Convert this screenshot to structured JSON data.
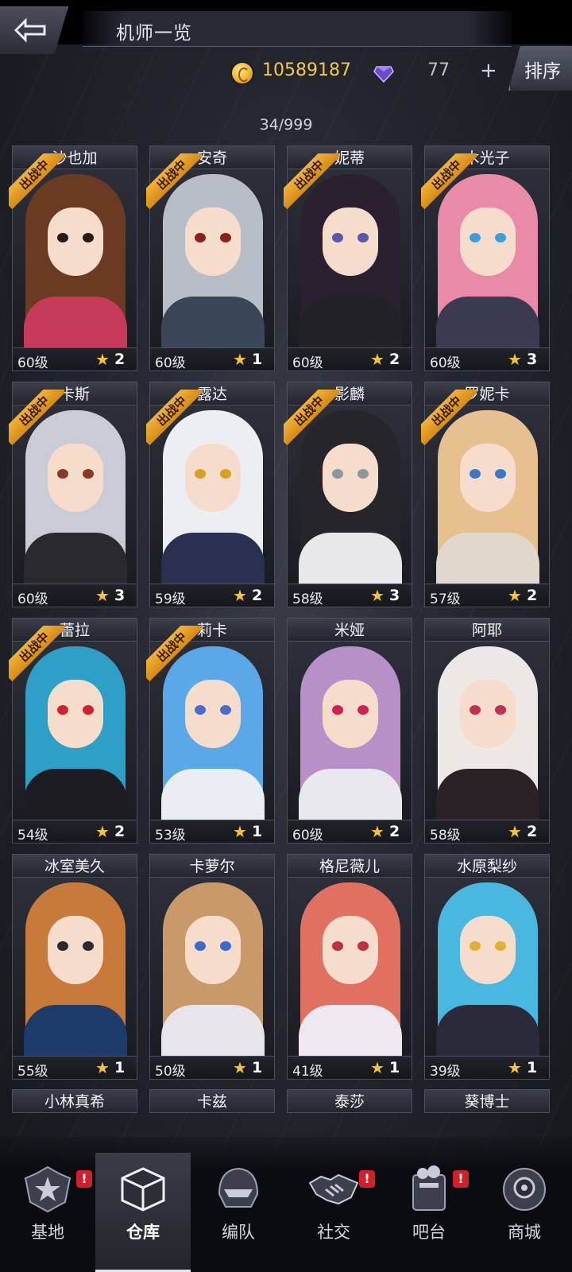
{
  "header": {
    "title": "机师一览",
    "coins": "10589187",
    "gems": "77",
    "plus": "+",
    "sort_label": "排序",
    "count": "34/999"
  },
  "status_badge_text": "出战中",
  "pilots": [
    {
      "name": "沙也加",
      "level": "60级",
      "stars": "2",
      "deployed": true
    },
    {
      "name": "安奇",
      "level": "60级",
      "stars": "1",
      "deployed": true
    },
    {
      "name": "妮蒂",
      "level": "60级",
      "stars": "2",
      "deployed": true
    },
    {
      "name": "木光子",
      "level": "60级",
      "stars": "3",
      "deployed": true
    },
    {
      "name": "卡斯",
      "level": "60级",
      "stars": "3",
      "deployed": true
    },
    {
      "name": "露达",
      "level": "59级",
      "stars": "2",
      "deployed": true
    },
    {
      "name": "影麟",
      "level": "58级",
      "stars": "3",
      "deployed": true
    },
    {
      "name": "罗妮卡",
      "level": "57级",
      "stars": "2",
      "deployed": true
    },
    {
      "name": "蕾拉",
      "level": "54级",
      "stars": "2",
      "deployed": true
    },
    {
      "name": "莉卡",
      "level": "53级",
      "stars": "1",
      "deployed": true
    },
    {
      "name": "米娅",
      "level": "60级",
      "stars": "2",
      "deployed": false
    },
    {
      "name": "阿耶",
      "level": "58级",
      "stars": "2",
      "deployed": false
    },
    {
      "name": "冰室美久",
      "level": "55级",
      "stars": "1",
      "deployed": false
    },
    {
      "name": "卡萝尔",
      "level": "50级",
      "stars": "1",
      "deployed": false
    },
    {
      "name": "格尼薇儿",
      "level": "41级",
      "stars": "1",
      "deployed": false
    },
    {
      "name": "水原梨纱",
      "level": "39级",
      "stars": "1",
      "deployed": false
    }
  ],
  "next_row_names": [
    "小林真希",
    "卡兹",
    "泰莎",
    "葵博士"
  ],
  "nav": [
    {
      "label": "基地",
      "icon": "base-star-icon",
      "alert": true
    },
    {
      "label": "仓库",
      "icon": "warehouse-cube-icon",
      "alert": false,
      "active": true
    },
    {
      "label": "编队",
      "icon": "formation-helmet-icon",
      "alert": false
    },
    {
      "label": "社交",
      "icon": "handshake-icon",
      "alert": true
    },
    {
      "label": "吧台",
      "icon": "bar-counter-icon",
      "alert": true
    },
    {
      "label": "商城",
      "icon": "shop-robot-icon",
      "alert": false
    }
  ],
  "alert_mark": "!",
  "colors": {
    "coin": "#f4c84a",
    "badge": "#e9a226",
    "star": "#f7c433",
    "alert": "#d2202a"
  }
}
